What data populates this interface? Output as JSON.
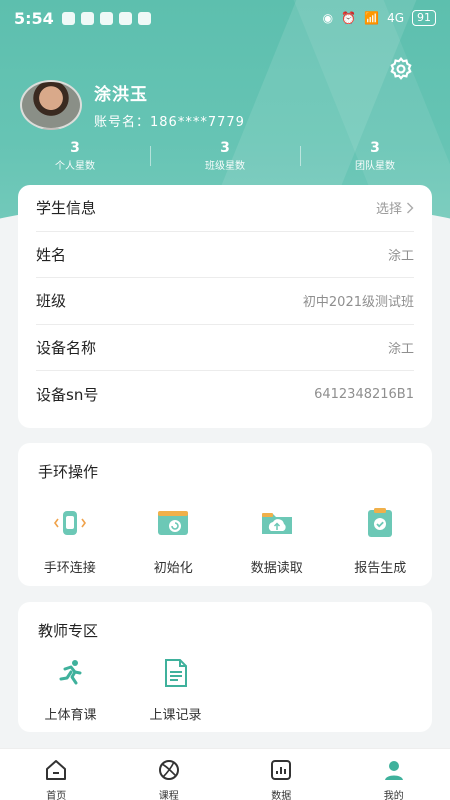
{
  "status_bar": {
    "time": "5:54",
    "network": "4G",
    "battery": "91"
  },
  "profile": {
    "name": "涂洪玉",
    "account_label": "账号名：",
    "account": "186****7779"
  },
  "stats": [
    {
      "value": "3",
      "label": "个人星数"
    },
    {
      "value": "3",
      "label": "班级星数"
    },
    {
      "value": "3",
      "label": "团队星数"
    }
  ],
  "student_info": {
    "title": "学生信息",
    "select_label": "选择",
    "rows": [
      {
        "key": "姓名",
        "value": "涂工"
      },
      {
        "key": "班级",
        "value": "初中2021级测试班"
      },
      {
        "key": "设备名称",
        "value": "涂工"
      },
      {
        "key": "设备sn号",
        "value": "6412348216B1"
      }
    ]
  },
  "band_ops": {
    "title": "手环操作",
    "items": [
      {
        "label": "手环连接",
        "icon": "band-connect-icon"
      },
      {
        "label": "初始化",
        "icon": "init-icon"
      },
      {
        "label": "数据读取",
        "icon": "data-read-icon"
      },
      {
        "label": "报告生成",
        "icon": "report-icon"
      }
    ]
  },
  "teacher": {
    "title": "教师专区",
    "items": [
      {
        "label": "上体育课",
        "icon": "running-icon"
      },
      {
        "label": "上课记录",
        "icon": "document-icon"
      }
    ]
  },
  "tabs": [
    {
      "label": "首页",
      "icon": "home-icon"
    },
    {
      "label": "课程",
      "icon": "ball-icon"
    },
    {
      "label": "数据",
      "icon": "chart-icon"
    },
    {
      "label": "我的",
      "icon": "user-icon"
    }
  ],
  "colors": {
    "accent": "#5dbfae",
    "card_bg": "#ffffff",
    "page_bg": "#f2f4f5"
  }
}
